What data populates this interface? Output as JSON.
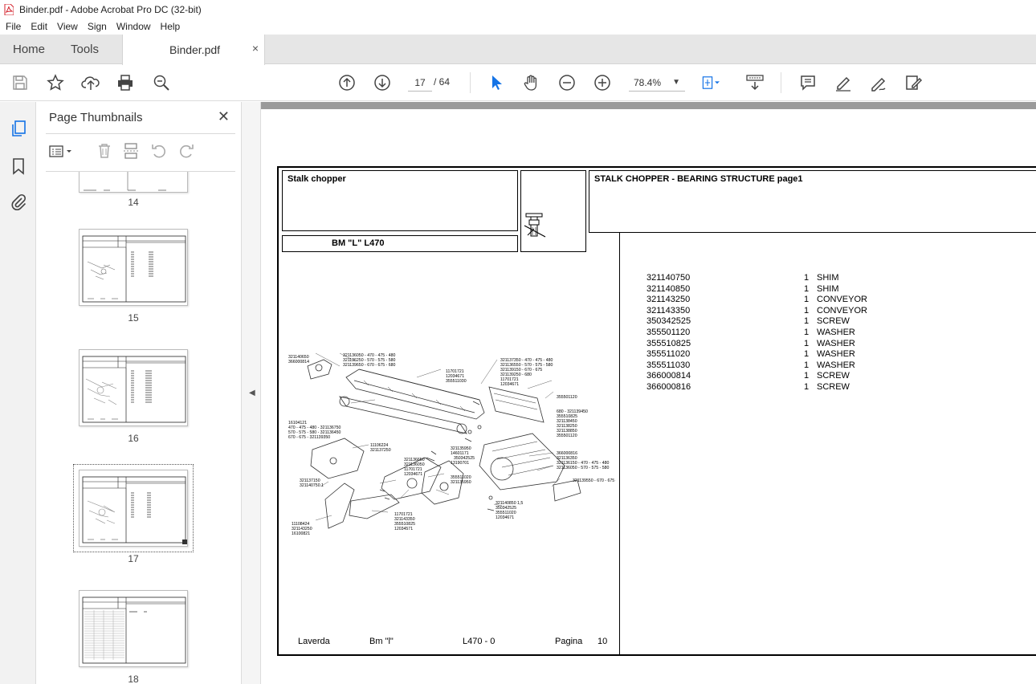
{
  "window": {
    "title": "Binder.pdf - Adobe Acrobat Pro DC (32-bit)"
  },
  "menu": [
    "File",
    "Edit",
    "View",
    "Sign",
    "Window",
    "Help"
  ],
  "tabs": {
    "home": "Home",
    "tools": "Tools",
    "document": "Binder.pdf",
    "close": "×"
  },
  "toolbar": {
    "current_page": "17",
    "total_pages": "/ 64",
    "zoom": "78.4%"
  },
  "thumbnails": {
    "title": "Page Thumbnails",
    "close": "✕",
    "items": [
      {
        "label": "14"
      },
      {
        "label": "15"
      },
      {
        "label": "16"
      },
      {
        "label": "17"
      },
      {
        "label": "18"
      }
    ],
    "selected": "17"
  },
  "pdf_page": {
    "section": "Stalk chopper",
    "header_title": "STALK CHOPPER - BEARING STRUCTURE  page1",
    "model": "BM \"L\"  L470",
    "parts": [
      {
        "code": "321140750",
        "qty": "1",
        "desc": "SHIM"
      },
      {
        "code": "321140850",
        "qty": "1",
        "desc": "SHIM"
      },
      {
        "code": "321143250",
        "qty": "1",
        "desc": "CONVEYOR"
      },
      {
        "code": "321143350",
        "qty": "1",
        "desc": "CONVEYOR"
      },
      {
        "code": "350342525",
        "qty": "1",
        "desc": "SCREW"
      },
      {
        "code": "355501120",
        "qty": "1",
        "desc": "WASHER"
      },
      {
        "code": "355510825",
        "qty": "1",
        "desc": "WASHER"
      },
      {
        "code": "355511020",
        "qty": "1",
        "desc": "WASHER"
      },
      {
        "code": "355511030",
        "qty": "1",
        "desc": "WASHER"
      },
      {
        "code": "366000814",
        "qty": "1",
        "desc": "SCREW"
      },
      {
        "code": "366000816",
        "qty": "1",
        "desc": "SCREW"
      }
    ],
    "footer": {
      "brand": "Laverda",
      "model": "Bm \"l\"",
      "code": "L470 - 0",
      "page_label": "Pagina",
      "page_number": "10"
    },
    "diagram_labels": [
      "321140650",
      "366000814",
      "321136050 - 470 - 475 - 480",
      "321136250 - 570 - 575 - 580",
      "321139650 - 670 - 675 - 680",
      "11701721",
      "12034671",
      "355511030",
      "321137350 - 470 - 475 - 480",
      "321136550 - 570 - 575 - 580",
      "321139150 - 670 - 675",
      "321139250 - 680",
      "11701721",
      "12034671",
      "355501120",
      "16104121",
      "470 - 475 - 480 - 321136750",
      "570 - 575 - 580 - 321136450",
      "670 - 675 - 321139350",
      "680 - 321139450",
      "355510825",
      "321138450",
      "321138250",
      "321138850",
      "355501120",
      "11106224",
      "321137250",
      "321135950",
      "14601171",
      "350342525",
      "13190701",
      "366000816",
      "321136350",
      "321136150 - 470 - 475 - 480",
      "321136050 - 570 - 575 - 580",
      "321139550 - 670 - 675 - 680",
      "321136650",
      "321136050",
      "11701721",
      "12034671",
      "355511020",
      "321135950",
      "321137150",
      "321140750  1",
      "321140850  1,5",
      "350342525",
      "355511020",
      "12034671",
      "11701721",
      "321143350",
      "355510825",
      "12034571",
      "11108424",
      "321143250",
      "16100821",
      "12034571"
    ]
  }
}
